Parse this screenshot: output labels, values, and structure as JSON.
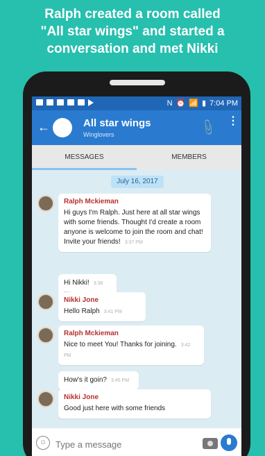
{
  "headline": {
    "line1": "Ralph created a room called",
    "line2": "\"All star wings\" and started a",
    "line3": "conversation and met Nikki"
  },
  "statusbar": {
    "time": "7:04 PM"
  },
  "appbar": {
    "title": "All star wings",
    "subtitle": "Winglovers"
  },
  "tabs": [
    {
      "label": "MESSAGES",
      "selected": true
    },
    {
      "label": "MEMBERS",
      "selected": false
    }
  ],
  "chat": {
    "date": "July 16, 2017",
    "messages": [
      {
        "sender": "Ralph Mckieman",
        "text": "Hi guys I'm Ralph. Just here at all star wings with some friends. Thought I'd create a room anyone is welcome to join the room and chat! Invite your friends!",
        "time": "3:37 PM"
      },
      {
        "sender": "",
        "text": "Hi Nikki!",
        "time": "3:38 PM"
      },
      {
        "sender": "Nikki Jone",
        "text": "Hello Ralph",
        "time": "3:41 PM"
      },
      {
        "sender": "Ralph Mckieman",
        "text": "Nice to meet You! Thanks for joining.",
        "time": "3:42 PM"
      },
      {
        "sender": "",
        "text": "How's it goin?",
        "time": "3:45 PM"
      },
      {
        "sender": "Nikki Jone",
        "text": "Good just here with some friends",
        "time": ""
      }
    ]
  },
  "input": {
    "placeholder": "Type a message"
  },
  "colors": {
    "background": "#27bfae",
    "statusbar": "#1f66b6",
    "appbar": "#2a7bd0",
    "sender": "#b63131",
    "date_chip": "#bde2f8"
  }
}
